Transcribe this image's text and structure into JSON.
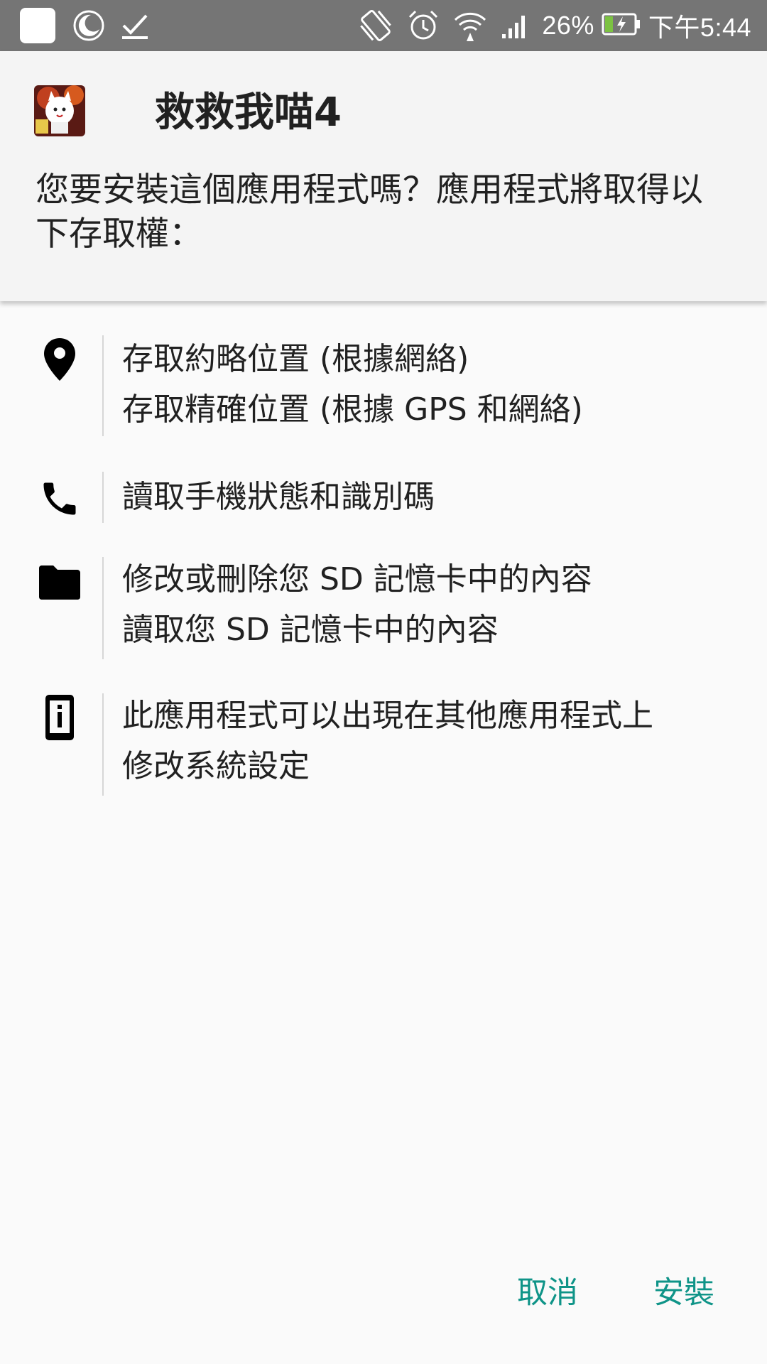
{
  "status_bar": {
    "battery_percent": "26%",
    "time": "下午5:44",
    "icons": [
      "notification-square-icon",
      "night-mode-icon",
      "download-done-icon",
      "auto-rotate-icon",
      "alarm-icon",
      "wifi-icon",
      "cellular-signal-icon",
      "battery-charging-icon"
    ]
  },
  "header": {
    "app_name": "救救我喵4",
    "question": "您要安裝這個應用程式嗎？應用程式將取得以下存取權："
  },
  "permissions": [
    {
      "icon": "location-pin-icon",
      "lines": [
        "存取約略位置 (根據網絡)",
        "存取精確位置 (根據 GPS 和網絡)"
      ]
    },
    {
      "icon": "phone-icon",
      "lines": [
        "讀取手機狀態和識別碼"
      ]
    },
    {
      "icon": "folder-icon",
      "lines": [
        "修改或刪除您 SD 記憶卡中的內容",
        "讀取您 SD 記憶卡中的內容"
      ]
    },
    {
      "icon": "device-info-icon",
      "lines": [
        "此應用程式可以出現在其他應用程式上",
        "修改系統設定"
      ]
    }
  ],
  "buttons": {
    "cancel": "取消",
    "install": "安裝"
  },
  "colors": {
    "status_bar": "#757575",
    "header_bg": "#f4f4f4",
    "page_bg": "#fafafa",
    "accent": "#0f9488"
  }
}
